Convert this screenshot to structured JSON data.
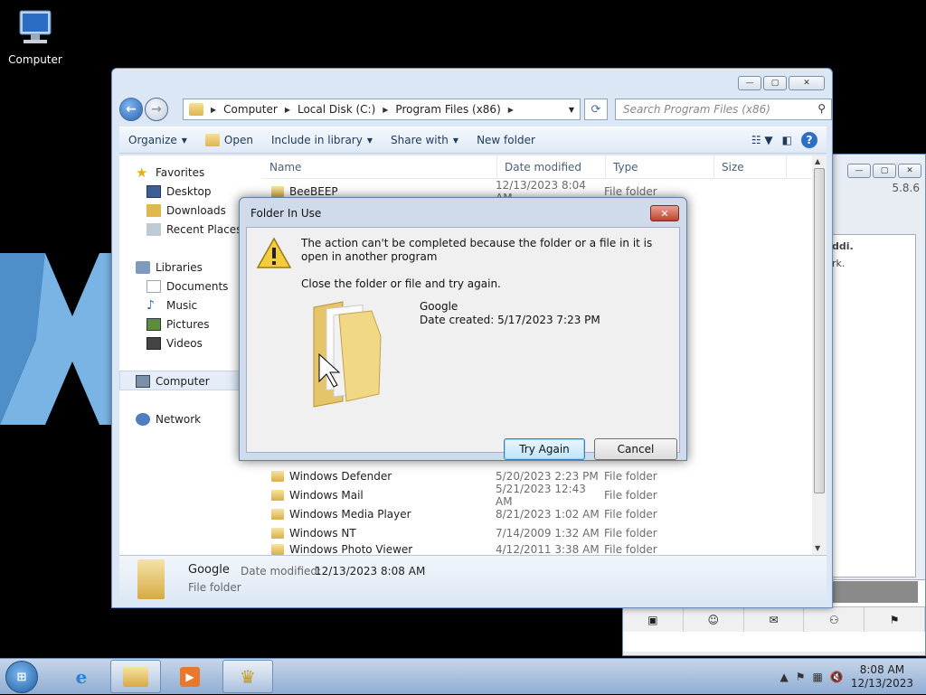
{
  "desktop": {
    "icon_label": "Computer"
  },
  "back_window": {
    "version": "5.8.6",
    "text1": "ddi.",
    "text2": "rk."
  },
  "explorer": {
    "address_parts": [
      "Computer",
      "Local Disk (C:)",
      "Program Files (x86)"
    ],
    "search_placeholder": "Search Program Files (x86)",
    "toolbar": {
      "organize": "Organize",
      "open": "Open",
      "include": "Include in library",
      "share": "Share with",
      "new_folder": "New folder"
    },
    "sidebar": {
      "favorites": "Favorites",
      "desktop": "Desktop",
      "downloads": "Downloads",
      "recent": "Recent Places",
      "libraries": "Libraries",
      "documents": "Documents",
      "music": "Music",
      "pictures": "Pictures",
      "videos": "Videos",
      "computer": "Computer",
      "network": "Network"
    },
    "columns": {
      "name": "Name",
      "date": "Date modified",
      "type": "Type",
      "size": "Size"
    },
    "rows": [
      {
        "name": "BeeBEEP",
        "date": "12/13/2023 8:04 AM",
        "type": "File folder"
      },
      {
        "name": "Windows Defender",
        "date": "5/20/2023 2:23 PM",
        "type": "File folder"
      },
      {
        "name": "Windows Mail",
        "date": "5/21/2023 12:43 AM",
        "type": "File folder"
      },
      {
        "name": "Windows Media Player",
        "date": "8/21/2023 1:02 AM",
        "type": "File folder"
      },
      {
        "name": "Windows NT",
        "date": "7/14/2009 1:32 AM",
        "type": "File folder"
      },
      {
        "name": "Windows Photo Viewer",
        "date": "4/12/2011 3:38 AM",
        "type": "File folder"
      }
    ],
    "details": {
      "name": "Google",
      "date_label": "Date modified:",
      "date_value": "12/13/2023 8:08 AM",
      "type": "File folder"
    }
  },
  "dialog": {
    "title": "Folder In Use",
    "message": "The action can't be completed because the folder or a file in it is open in another program",
    "hint": "Close the folder or file and try again.",
    "item_name": "Google",
    "item_date": "Date created: 5/17/2023 7:23 PM",
    "try_again": "Try Again",
    "cancel": "Cancel"
  },
  "taskbar": {
    "time": "8:08 AM",
    "date": "12/13/2023"
  }
}
